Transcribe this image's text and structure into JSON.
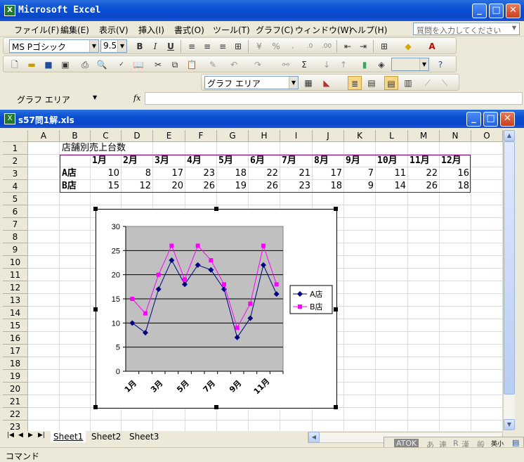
{
  "app": {
    "title": "Microsoft Excel"
  },
  "menu": [
    "ファイル(F)",
    "編集(E)",
    "表示(V)",
    "挿入(I)",
    "書式(O)",
    "ツール(T)",
    "グラフ(C)",
    "ウィンドウ(W)",
    "ヘルプ(H)"
  ],
  "help_placeholder": "質問を入力してください",
  "toolbar": {
    "font_name": "MS Pゴシック",
    "font_size": "9.5",
    "chart_object": "グラフ エリア"
  },
  "namebox": "グラフ エリア",
  "fx": "fx",
  "workbook": {
    "title": "s57問1解.xls"
  },
  "columns": [
    "A",
    "B",
    "C",
    "D",
    "E",
    "F",
    "G",
    "H",
    "I",
    "J",
    "K",
    "L",
    "M",
    "N",
    "O"
  ],
  "rows": [
    "1",
    "2",
    "3",
    "4",
    "5",
    "6",
    "7",
    "8",
    "9",
    "10",
    "11",
    "12",
    "13",
    "14",
    "15",
    "16",
    "17",
    "18",
    "19",
    "20",
    "21",
    "22",
    "23"
  ],
  "sheet": {
    "title": "店舗別売上台数",
    "months": [
      "1月",
      "2月",
      "3月",
      "4月",
      "5月",
      "6月",
      "7月",
      "8月",
      "9月",
      "10月",
      "11月",
      "12月"
    ],
    "storeA": {
      "label": "A店",
      "values": [
        10,
        8,
        17,
        23,
        18,
        22,
        21,
        17,
        7,
        11,
        22,
        16
      ]
    },
    "storeB": {
      "label": "B店",
      "values": [
        15,
        12,
        20,
        26,
        19,
        26,
        23,
        18,
        9,
        14,
        26,
        18
      ]
    }
  },
  "chart_data": {
    "type": "line",
    "categories": [
      "1月",
      "2月",
      "3月",
      "4月",
      "5月",
      "6月",
      "7月",
      "8月",
      "9月",
      "10月",
      "11月",
      "12月"
    ],
    "tick_labels": [
      "1月",
      "3月",
      "5月",
      "7月",
      "9月",
      "11月"
    ],
    "yticks": [
      "0",
      "5",
      "10",
      "15",
      "20",
      "25",
      "30"
    ],
    "series": [
      {
        "name": "A店",
        "values": [
          10,
          8,
          17,
          23,
          18,
          22,
          21,
          17,
          7,
          11,
          22,
          16
        ],
        "color": "#000080",
        "marker": "diamond"
      },
      {
        "name": "B店",
        "values": [
          15,
          12,
          20,
          26,
          19,
          26,
          23,
          18,
          9,
          14,
          26,
          18
        ],
        "color": "#ff00ff",
        "marker": "square"
      }
    ],
    "ylim": [
      0,
      30
    ],
    "plot_bg": "#c0c0c0",
    "grid": true,
    "legend": "right"
  },
  "tabs": [
    "Sheet1",
    "Sheet2",
    "Sheet3"
  ],
  "status": "コマンド",
  "ime": [
    "ATOK",
    "あ",
    "連",
    "R",
    "漢",
    "般",
    "英小"
  ]
}
